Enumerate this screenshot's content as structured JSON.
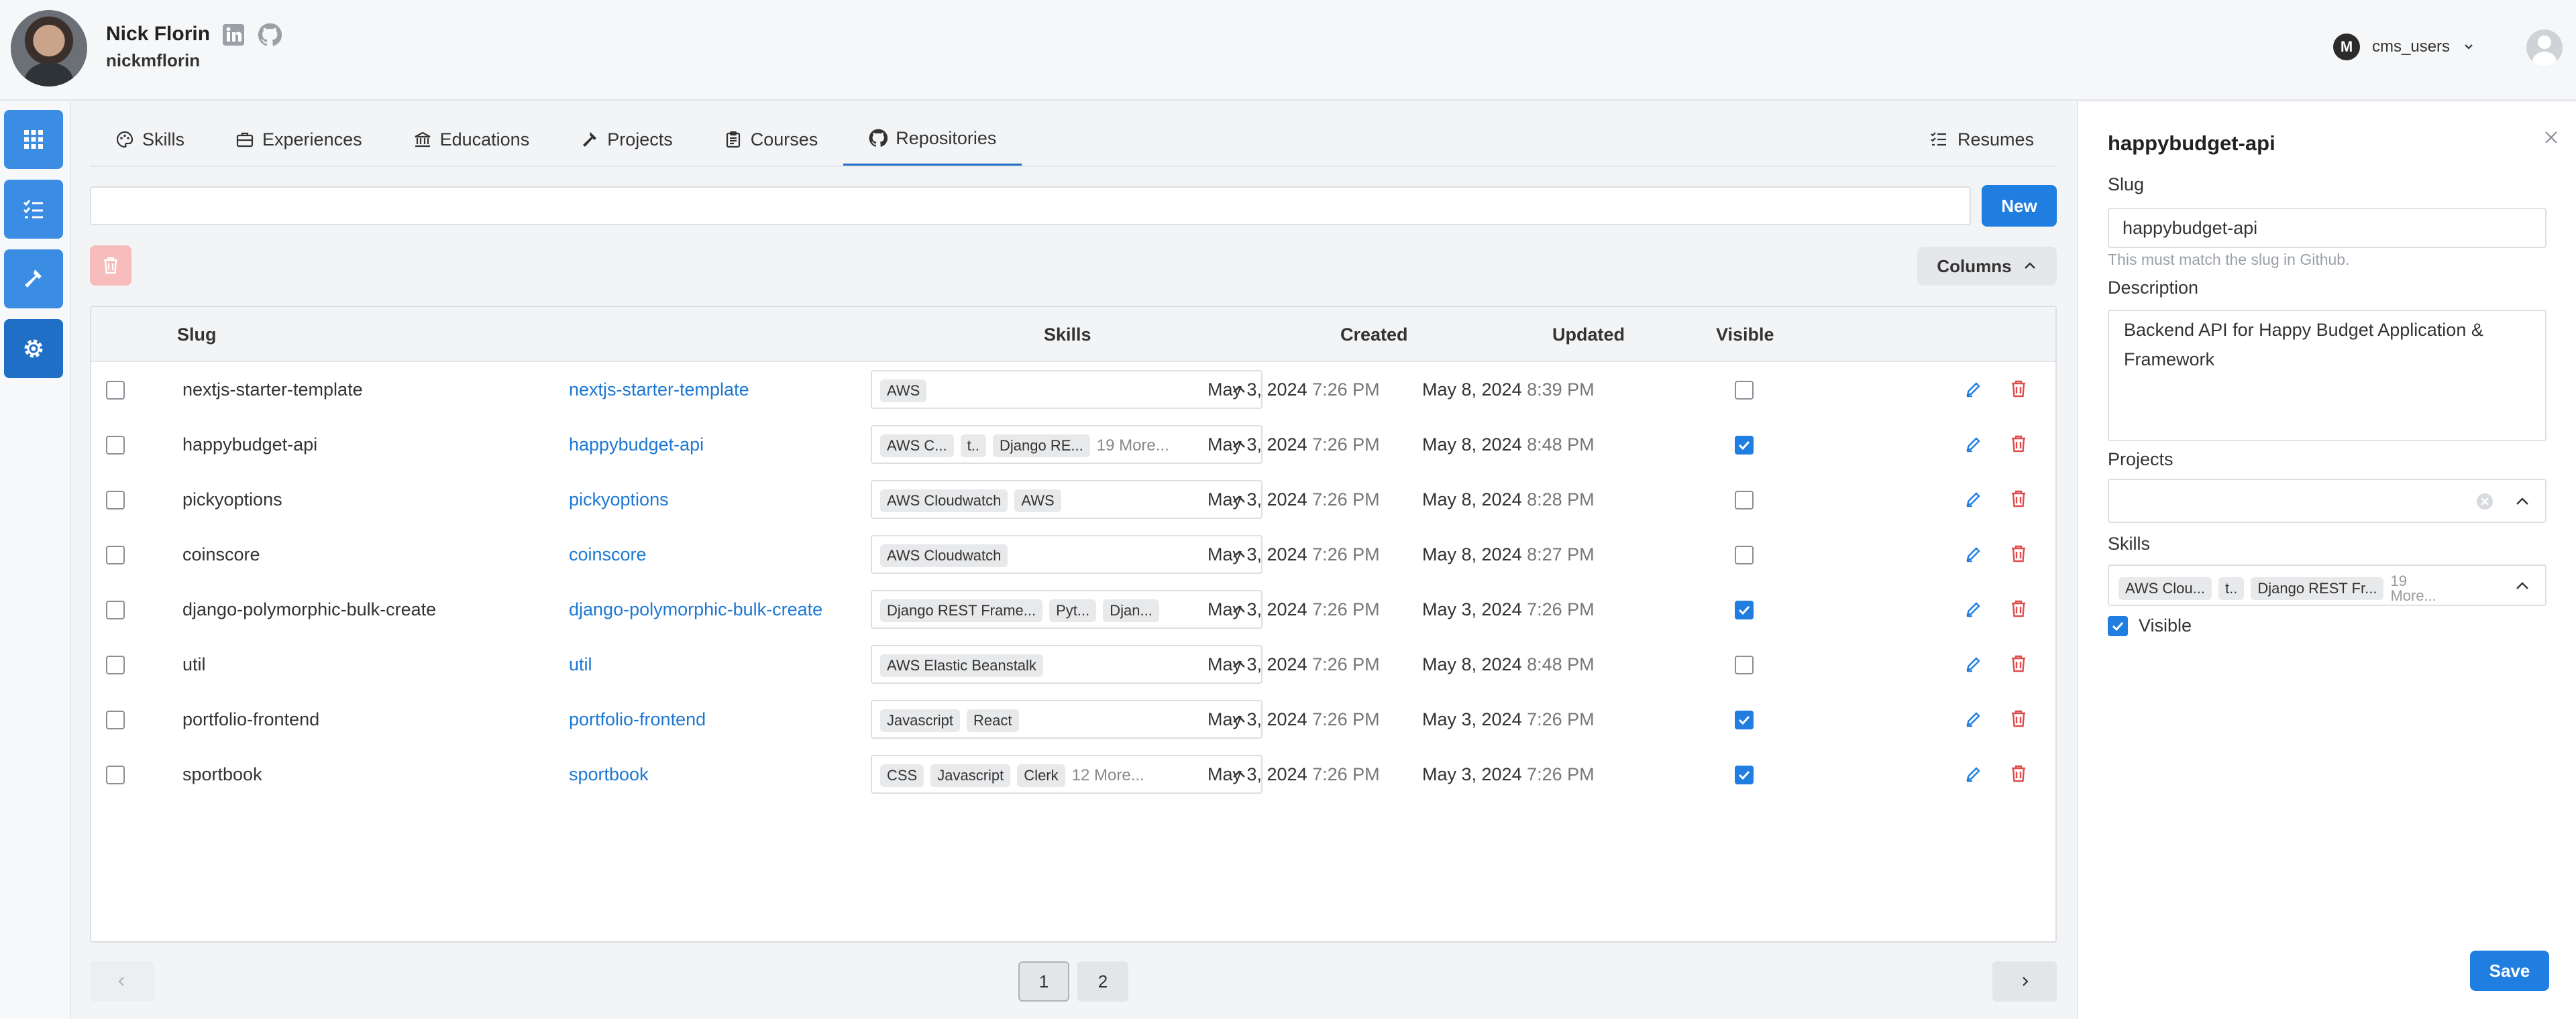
{
  "header": {
    "name": "Nick Florin",
    "username": "nickmflorin",
    "tenant": "cms_users"
  },
  "tabs": [
    {
      "label": "Skills",
      "icon": "palette-icon"
    },
    {
      "label": "Experiences",
      "icon": "briefcase-icon"
    },
    {
      "label": "Educations",
      "icon": "bank-icon"
    },
    {
      "label": "Projects",
      "icon": "hammer-icon"
    },
    {
      "label": "Courses",
      "icon": "clipboard-icon"
    },
    {
      "label": "Repositories",
      "icon": "github-icon"
    }
  ],
  "resumes_label": "Resumes",
  "toolbar": {
    "new_label": "New",
    "columns_label": "Columns",
    "search_value": ""
  },
  "table": {
    "headers": {
      "slug": "Slug",
      "skills": "Skills",
      "created": "Created",
      "updated": "Updated",
      "visible": "Visible"
    },
    "rows": [
      {
        "slug": "nextjs-starter-template",
        "link": "nextjs-starter-template",
        "chips": [
          "AWS"
        ],
        "more": "",
        "created_date": "May 3, 2024",
        "created_time": "7:26 PM",
        "updated_date": "May 8, 2024",
        "updated_time": "8:39 PM",
        "visible": false
      },
      {
        "slug": "happybudget-api",
        "link": "happybudget-api",
        "chips": [
          "AWS C...",
          "t..",
          "Django RE..."
        ],
        "more": "19 More...",
        "created_date": "May 3, 2024",
        "created_time": "7:26 PM",
        "updated_date": "May 8, 2024",
        "updated_time": "8:48 PM",
        "visible": true
      },
      {
        "slug": "pickyoptions",
        "link": "pickyoptions",
        "chips": [
          "AWS Cloudwatch",
          "AWS"
        ],
        "more": "",
        "created_date": "May 3, 2024",
        "created_time": "7:26 PM",
        "updated_date": "May 8, 2024",
        "updated_time": "8:28 PM",
        "visible": false
      },
      {
        "slug": "coinscore",
        "link": "coinscore",
        "chips": [
          "AWS Cloudwatch"
        ],
        "more": "",
        "created_date": "May 3, 2024",
        "created_time": "7:26 PM",
        "updated_date": "May 8, 2024",
        "updated_time": "8:27 PM",
        "visible": false
      },
      {
        "slug": "django-polymorphic-bulk-create",
        "link": "django-polymorphic-bulk-create",
        "chips": [
          "Django REST Frame...",
          "Pyt...",
          "Djan..."
        ],
        "more": "",
        "created_date": "May 3, 2024",
        "created_time": "7:26 PM",
        "updated_date": "May 3, 2024",
        "updated_time": "7:26 PM",
        "visible": true
      },
      {
        "slug": "util",
        "link": "util",
        "chips": [
          "AWS Elastic Beanstalk"
        ],
        "more": "",
        "created_date": "May 3, 2024",
        "created_time": "7:26 PM",
        "updated_date": "May 8, 2024",
        "updated_time": "8:48 PM",
        "visible": false
      },
      {
        "slug": "portfolio-frontend",
        "link": "portfolio-frontend",
        "chips": [
          "Javascript",
          "React"
        ],
        "more": "",
        "created_date": "May 3, 2024",
        "created_time": "7:26 PM",
        "updated_date": "May 3, 2024",
        "updated_time": "7:26 PM",
        "visible": true
      },
      {
        "slug": "sportbook",
        "link": "sportbook",
        "chips": [
          "CSS",
          "Javascript",
          "Clerk"
        ],
        "more": "12 More...",
        "created_date": "May 3, 2024",
        "created_time": "7:26 PM",
        "updated_date": "May 3, 2024",
        "updated_time": "7:26 PM",
        "visible": true
      }
    ]
  },
  "pagination": {
    "pages": [
      "1",
      "2"
    ],
    "current": "1"
  },
  "panel": {
    "title": "happybudget-api",
    "slug_label": "Slug",
    "slug_value": "happybudget-api",
    "slug_hint": "This must match the slug in Github.",
    "description_label": "Description",
    "description_value": "Backend API for Happy Budget Application & Framework",
    "projects_label": "Projects",
    "skills_label": "Skills",
    "skills_chips": [
      "AWS Clou...",
      "t..",
      "Django REST Fr..."
    ],
    "skills_more": "19 More...",
    "visible_label": "Visible",
    "save_label": "Save"
  },
  "colors": {
    "primary": "#1f7ee0",
    "danger": "#e04b4b",
    "link": "#1c78d4"
  }
}
